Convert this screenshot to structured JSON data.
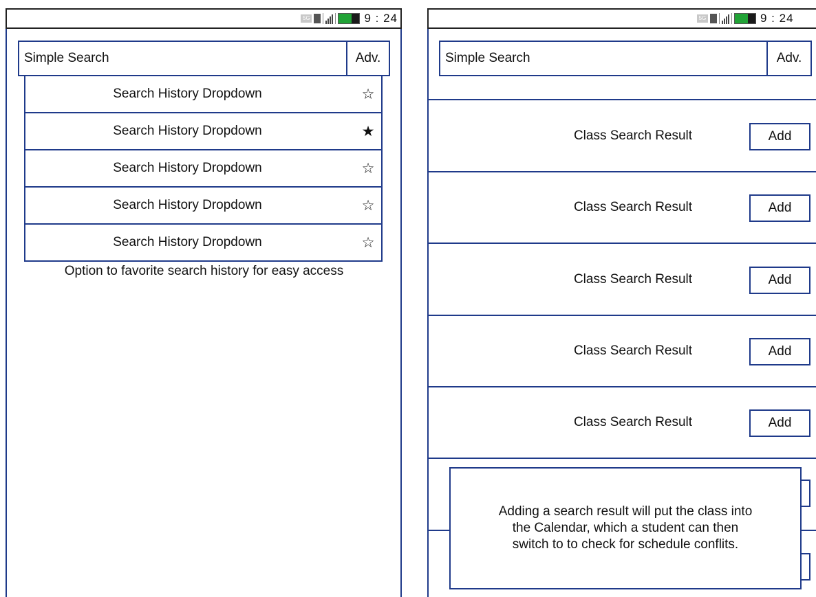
{
  "status_bar": {
    "network": "5G",
    "time": "9 : 24"
  },
  "left_screen": {
    "search_label": "Simple Search",
    "adv_label": "Adv.",
    "history_items": [
      {
        "label": "Search History Dropdown",
        "star": "☆",
        "favorited": false
      },
      {
        "label": "Search History Dropdown",
        "star": "★",
        "favorited": true
      },
      {
        "label": "Search History Dropdown",
        "star": "☆",
        "favorited": false
      },
      {
        "label": "Search History Dropdown",
        "star": "☆",
        "favorited": false
      },
      {
        "label": "Search History Dropdown",
        "star": "☆",
        "favorited": false
      }
    ],
    "note": "Option to favorite search history for easy access"
  },
  "right_screen": {
    "search_label": "Simple Search",
    "adv_label": "Adv.",
    "results": [
      {
        "label": "Class Search Result",
        "button": "Add"
      },
      {
        "label": "Class Search Result",
        "button": "Add"
      },
      {
        "label": "Class Search Result",
        "button": "Add"
      },
      {
        "label": "Class Search Result",
        "button": "Add"
      },
      {
        "label": "Class Search Result",
        "button": "Add"
      }
    ],
    "callout_lines": [
      "Adding a search result will put the class into",
      "the Calendar, which a student can then",
      "switch to to check for schedule conflits."
    ]
  },
  "colors": {
    "frame": "#1f3a8a",
    "battery": "#21a336"
  }
}
